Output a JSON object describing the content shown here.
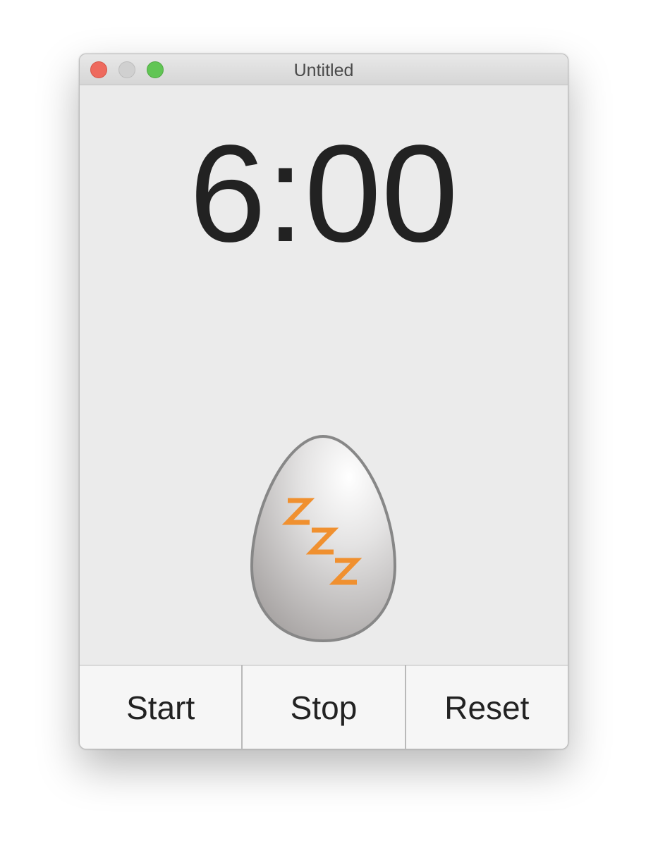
{
  "window": {
    "title": "Untitled",
    "controls": [
      "close",
      "minimize",
      "maximize"
    ]
  },
  "timer": {
    "display": "6:00"
  },
  "egg": {
    "icon": "sleeping-egg-icon",
    "zzz_color": "#f0902f"
  },
  "buttons": {
    "start": "Start",
    "stop": "Stop",
    "reset": "Reset"
  }
}
